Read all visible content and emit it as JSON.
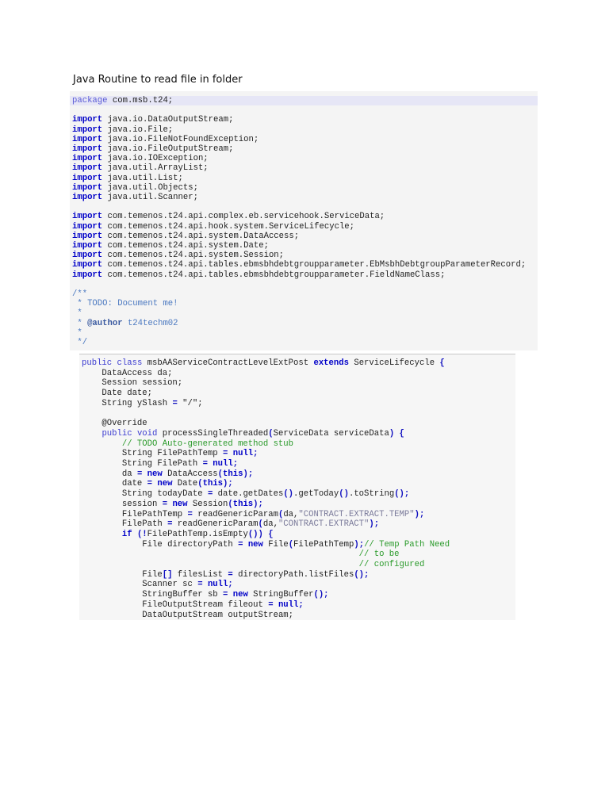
{
  "doc": {
    "title": "Java Routine to read file in folder"
  },
  "block1": {
    "package_kw": "package",
    "package_name": " com.msb.t24;",
    "imports": [
      "java.io.DataOutputStream;",
      "java.io.File;",
      "java.io.FileNotFoundException;",
      "java.io.FileOutputStream;",
      "java.io.IOException;",
      "java.util.ArrayList;",
      "java.util.List;",
      "java.util.Objects;",
      "java.util.Scanner;"
    ],
    "imports2": [
      "com.temenos.t24.api.complex.eb.servicehook.ServiceData;",
      "com.temenos.t24.api.hook.system.ServiceLifecycle;",
      "com.temenos.t24.api.system.DataAccess;",
      "com.temenos.t24.api.system.Date;",
      "com.temenos.t24.api.system.Session;",
      "com.temenos.t24.api.tables.ebmsbhdebtgroupparameter.EbMsbhDebtgroupParameterRecord;",
      "com.temenos.t24.api.tables.ebmsbhdebtgroupparameter.FieldNameClass;"
    ],
    "import_kw": "import",
    "javadoc": {
      "open": "/**",
      "todo": " * TODO: Document me!",
      "star": " *",
      "author_prefix": " * ",
      "author_tag": "@author",
      "author_name": " t24techm02",
      "close": " */"
    }
  },
  "block2": {
    "class_line": {
      "kw_public": "public",
      "kw_class": " class",
      "name": " msbAAServiceContractLevelExtPost ",
      "kw_extends": "extends",
      "parent": " ServiceLifecycle ",
      "brace": "{"
    },
    "fields": [
      "    DataAccess da;",
      "    Session session;",
      "    Date date;"
    ],
    "yslash": {
      "pre": "    String ySlash ",
      "op": "=",
      "post": " \"/\";"
    },
    "override": "    @Override",
    "method": {
      "kw_public": "public",
      "kw_void": " void",
      "name": " processSingleThreaded",
      "paren_open": "(",
      "params": "ServiceData serviceData",
      "paren_close": ")",
      "brace": " {"
    },
    "todo_comment": "// TODO Auto-generated method stub",
    "lines": {
      "l1_pre": "String FilePathTemp ",
      "l1_null": "null",
      "l2_pre": "String FilePath ",
      "l2_null": "null",
      "l3_pre": "da ",
      "l3_new": "new",
      "l3_post": " DataAccess",
      "l3_this": "this",
      "l4_pre": "date ",
      "l4_new": "new",
      "l4_post": " Date",
      "l4_this": "this",
      "l5_pre": "String todayDate ",
      "l5_mid": " date.getDates",
      "l5_mid2": ".getToday",
      "l5_mid3": ".toString",
      "l6_pre": "session ",
      "l6_new": "new",
      "l6_post": " Session",
      "l6_this": "this",
      "l7_pre": "FilePathTemp ",
      "l7_call": " readGenericParam",
      "l7_arg": "da,",
      "l7_str": "\"CONTRACT.EXTRACT.TEMP\"",
      "l8_pre": "FilePath ",
      "l8_call": " readGenericParam",
      "l8_arg": "da,",
      "l8_str": "\"CONTRACT.EXTRACT\"",
      "l9_if": "if",
      "l9_body": "FilePathTemp.isEmpty",
      "l10_pre": "File directoryPath ",
      "l10_new": "new",
      "l10_post": " File",
      "l10_arg": "FilePathTemp",
      "l10_cm": "// Temp Path Need",
      "l11_cm": "// to be",
      "l12_cm": "// configured",
      "l13_pre": "File",
      "l13_arr": "[]",
      "l13_post": " filesList ",
      "l13_call": " directoryPath.listFiles",
      "l14_pre": "Scanner sc ",
      "l14_null": "null",
      "l15_pre": "StringBuffer sb ",
      "l15_new": "new",
      "l15_post": " StringBuffer",
      "l16_pre": "FileOutputStream fileout ",
      "l16_null": "null",
      "l17": "DataOutputStream outputStream;"
    }
  }
}
